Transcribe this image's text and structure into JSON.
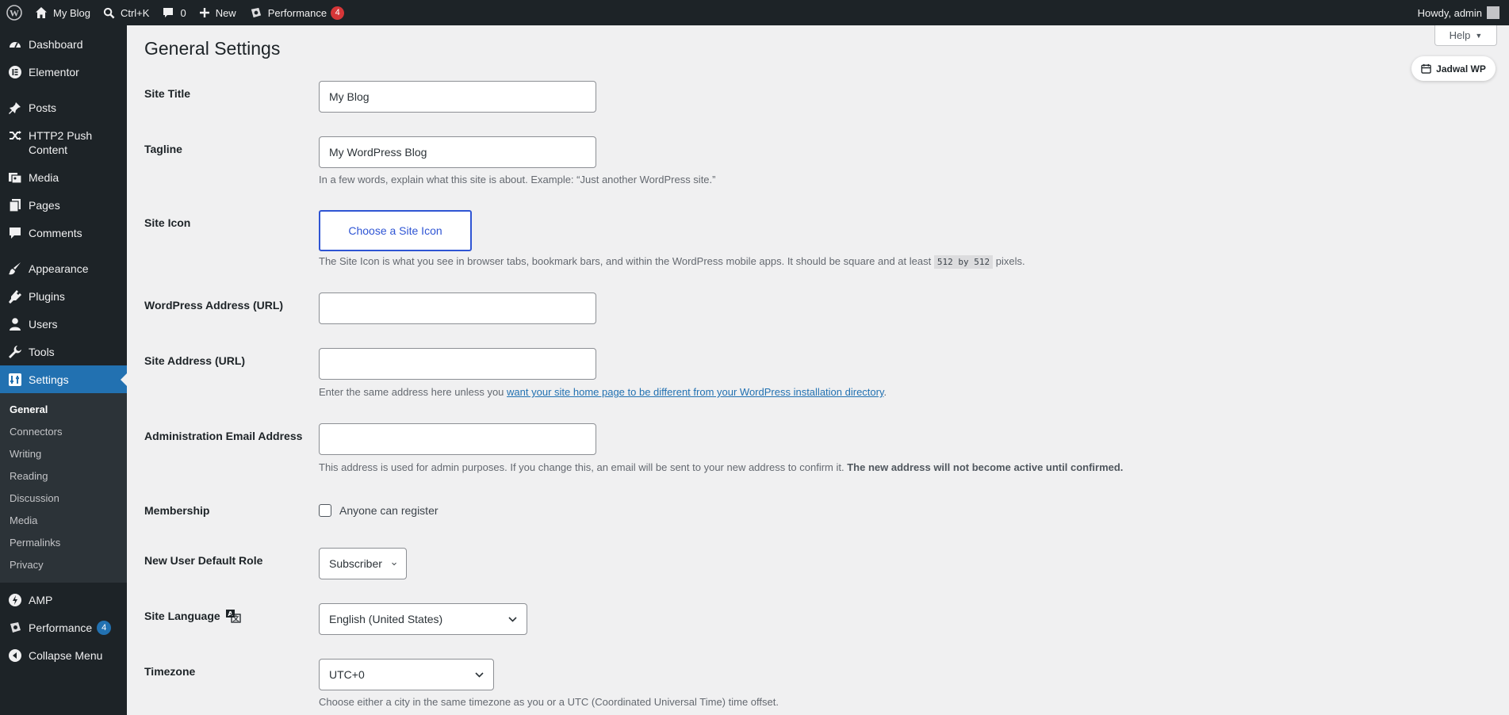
{
  "adminbar": {
    "site_name": "My Blog",
    "search_shortcut": "Ctrl+K",
    "comments_count": "0",
    "new_label": "New",
    "performance_label": "Performance",
    "performance_badge": "4",
    "howdy": "Howdy, admin"
  },
  "sidebar": {
    "items": [
      {
        "label": "Dashboard",
        "icon": "dashboard-icon"
      },
      {
        "label": "Elementor",
        "icon": "elementor-icon"
      },
      {
        "label": "Posts",
        "icon": "pin-icon"
      },
      {
        "label": "HTTP2 Push Content",
        "icon": "shuffle-icon"
      },
      {
        "label": "Media",
        "icon": "media-icon"
      },
      {
        "label": "Pages",
        "icon": "pages-icon"
      },
      {
        "label": "Comments",
        "icon": "comment-icon"
      },
      {
        "label": "Appearance",
        "icon": "brush-icon"
      },
      {
        "label": "Plugins",
        "icon": "plug-icon"
      },
      {
        "label": "Users",
        "icon": "user-icon"
      },
      {
        "label": "Tools",
        "icon": "wrench-icon"
      },
      {
        "label": "Settings",
        "icon": "settings-icon"
      }
    ],
    "submenu": [
      "General",
      "Connectors",
      "Writing",
      "Reading",
      "Discussion",
      "Media",
      "Permalinks",
      "Privacy"
    ],
    "bottom": [
      {
        "label": "AMP",
        "icon": "amp-icon"
      },
      {
        "label": "Performance",
        "icon": "performance-icon",
        "badge": "4"
      },
      {
        "label": "Collapse Menu",
        "icon": "collapse-icon"
      }
    ]
  },
  "page": {
    "title": "General Settings",
    "help": "Help",
    "jadwal": "Jadwal WP"
  },
  "form": {
    "site_title": {
      "label": "Site Title",
      "value": "My Blog"
    },
    "tagline": {
      "label": "Tagline",
      "value": "My WordPress Blog",
      "desc": "In a few words, explain what this site is about. Example: “Just another WordPress site.”"
    },
    "site_icon": {
      "label": "Site Icon",
      "button": "Choose a Site Icon",
      "desc_pre": "The Site Icon is what you see in browser tabs, bookmark bars, and within the WordPress mobile apps. It should be square and at least",
      "desc_code": "512 by 512",
      "desc_post": "pixels."
    },
    "wp_address": {
      "label": "WordPress Address (URL)",
      "value": ""
    },
    "site_address": {
      "label": "Site Address (URL)",
      "value": "",
      "desc_pre": "Enter the same address here unless you",
      "desc_link": "want your site home page to be different from your WordPress installation directory",
      "desc_post": "."
    },
    "admin_email": {
      "label": "Administration Email Address",
      "value": "",
      "desc_pre": "This address is used for admin purposes. If you change this, an email will be sent to your new address to confirm it.",
      "desc_bold": "The new address will not become active until confirmed."
    },
    "membership": {
      "label": "Membership",
      "checkbox_label": "Anyone can register",
      "checked": false
    },
    "default_role": {
      "label": "New User Default Role",
      "value": "Subscriber"
    },
    "site_language": {
      "label": "Site Language",
      "value": "English (United States)"
    },
    "timezone": {
      "label": "Timezone",
      "value": "UTC+0",
      "desc": "Choose either a city in the same timezone as you or a UTC (Coordinated Universal Time) time offset."
    }
  },
  "colors": {
    "accent": "#2271b1",
    "adminbar": "#1d2327",
    "badge_red": "#d63638",
    "site_icon_button": "#2f55d4"
  }
}
